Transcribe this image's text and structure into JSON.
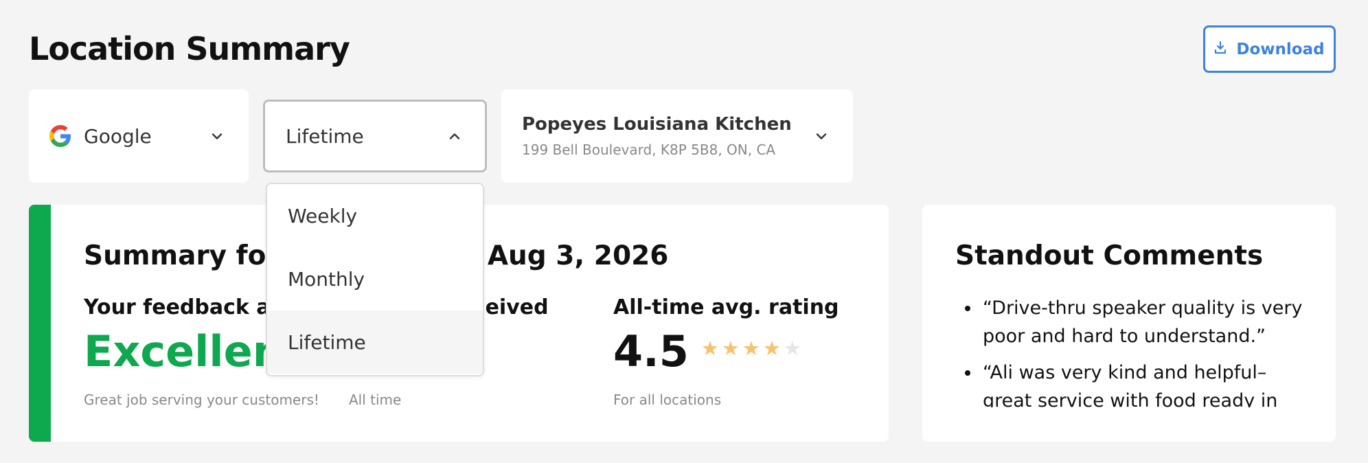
{
  "header": {
    "title": "Location Summary",
    "download_label": "Download"
  },
  "filters": {
    "platform": {
      "label": "Google",
      "icon": "google-logo-icon"
    },
    "period": {
      "label": "Lifetime",
      "expanded": true
    },
    "location": {
      "name": "Popeyes Louisiana Kitchen",
      "address": "199 Bell Boulevard, K8P 5B8, ON, CA"
    }
  },
  "dropdown": {
    "options": [
      "Weekly",
      "Monthly",
      "Lifetime"
    ],
    "selected": "Lifetime"
  },
  "summary": {
    "title": "Summary for Jan 1, 2026 - Aug 3, 2026",
    "feedback": {
      "heading": "Your feedback all time",
      "value": "Excellent",
      "note": "Great job serving your customers!"
    },
    "reviews": {
      "heading": "Reviews received",
      "value": "",
      "note": "All time"
    },
    "rating": {
      "heading": "All-time avg. rating",
      "value": "4.5",
      "stars": 4,
      "max_stars": 5,
      "note": "For all locations"
    },
    "accent_color": "#0ea84e"
  },
  "comments": {
    "title": "Standout Comments",
    "items": [
      "“Drive-thru speaker quality is very poor and hard to understand.”",
      "“Ali was very kind and helpful–great service with food ready in"
    ]
  },
  "colors": {
    "background": "#f4f4f4",
    "accent_green": "#0ea84e",
    "link_blue": "#3d82e0",
    "star_filled": "#f8c16e",
    "star_empty": "#e6e6e6"
  }
}
